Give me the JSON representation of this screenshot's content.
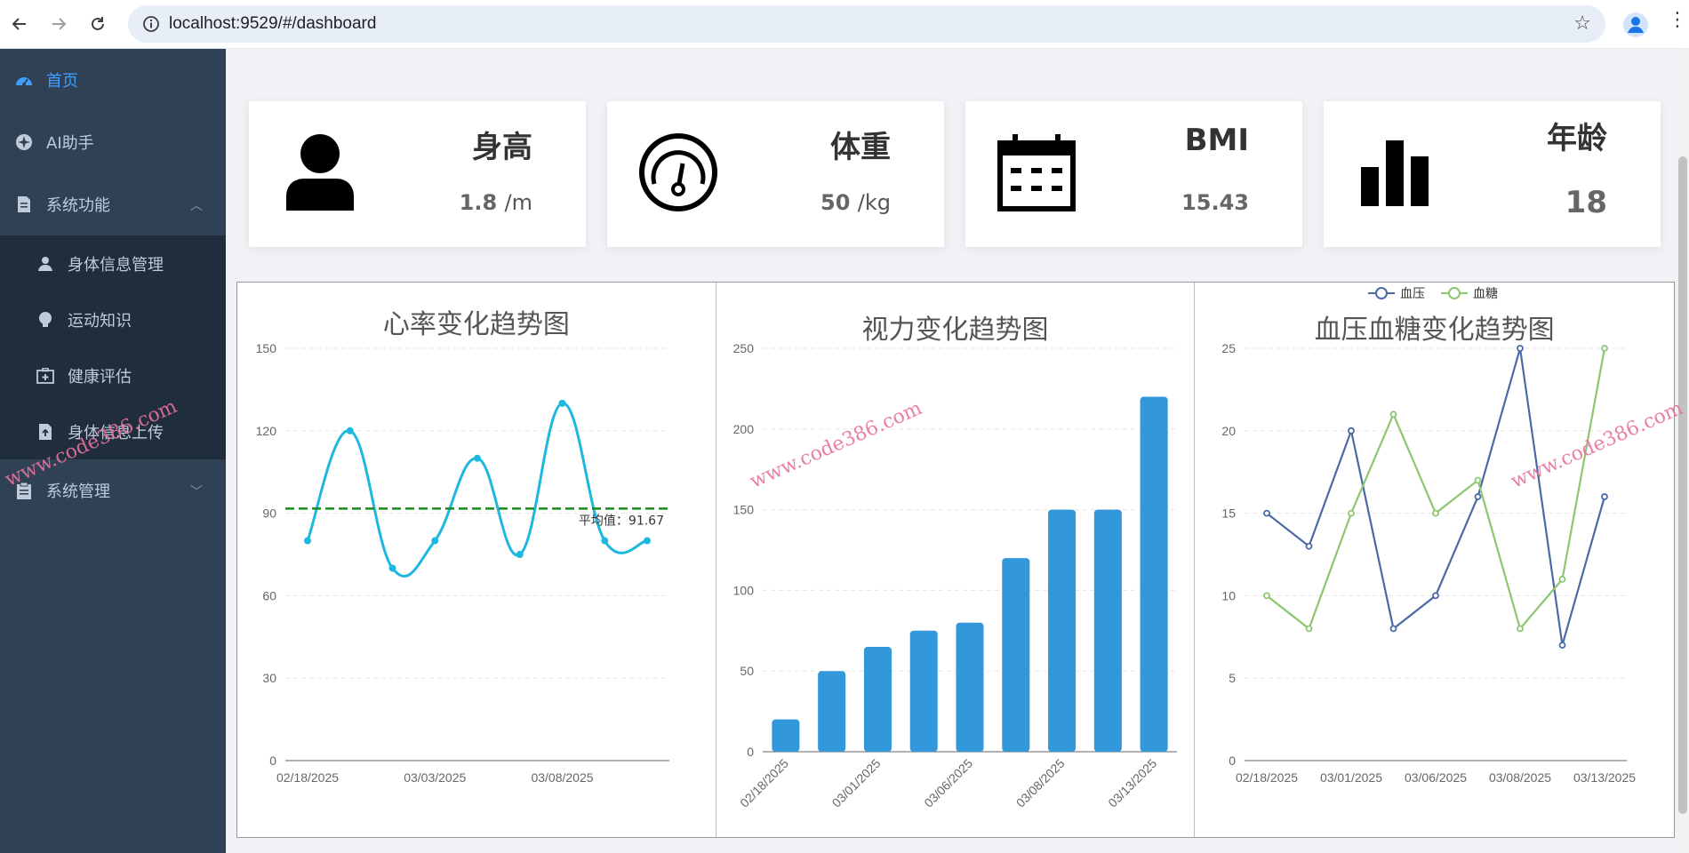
{
  "browser": {
    "url": "localhost:9529/#/dashboard",
    "back_icon": "arrow-left-icon",
    "forward_icon": "arrow-right-icon",
    "reload_icon": "reload-icon",
    "site_info_icon": "info-icon",
    "bookmark_icon": "star-icon",
    "profile_icon": "person-icon",
    "menu_icon": "kebab-icon"
  },
  "sidebar": {
    "items": [
      {
        "label": "首页",
        "icon": "dashboard-icon",
        "active": true
      },
      {
        "label": "AI助手",
        "icon": "compass-icon"
      },
      {
        "label": "系统功能",
        "icon": "document-icon",
        "expanded": true
      }
    ],
    "submenu": [
      {
        "label": "身体信息管理",
        "icon": "user-icon"
      },
      {
        "label": "运动知识",
        "icon": "bulb-icon"
      },
      {
        "label": "健康评估",
        "icon": "medical-box-icon"
      },
      {
        "label": "身体信息上传",
        "icon": "upload-doc-icon"
      }
    ],
    "bottom": {
      "label": "系统管理",
      "icon": "clipboard-icon"
    }
  },
  "cards": [
    {
      "title": "身高",
      "value": "1.8",
      "unit": "/m",
      "icon": "person-icon"
    },
    {
      "title": "体重",
      "value": "50",
      "unit": "/kg",
      "icon": "gauge-icon"
    },
    {
      "title": "BMI",
      "value": "15.43",
      "unit": "",
      "icon": "calendar-icon"
    },
    {
      "title": "年龄",
      "value": "18",
      "unit": "",
      "icon": "bar-chart-icon"
    }
  ],
  "watermark": "www.code386.com",
  "chart_data": [
    {
      "type": "line",
      "title": "心率变化趋势图",
      "x": [
        "02/18/2025",
        "",
        "",
        "03/03/2025",
        "",
        "",
        "03/08/2025",
        "",
        "",
        ""
      ],
      "x_tick_labels": [
        "02/18/2025",
        "03/03/2025",
        "03/08/2025"
      ],
      "series": [
        {
          "values": [
            80,
            120,
            70,
            80,
            110,
            75,
            130,
            80,
            80
          ],
          "color": "#1db8e0",
          "smooth": true
        }
      ],
      "mark_line": {
        "label": "平均值：91.67",
        "value": 91.67,
        "color": "#1a8a1a"
      },
      "ylim": [
        0,
        150
      ],
      "yticks": [
        0,
        30,
        60,
        90,
        120,
        150
      ],
      "grid": true
    },
    {
      "type": "bar",
      "title": "视力变化趋势图",
      "categories": [
        "02/18/2025",
        "",
        "03/01/2025",
        "",
        "03/06/2025",
        "",
        "03/08/2025",
        "",
        "03/13/2025"
      ],
      "x_tick_labels": [
        "02/18/2025",
        "03/01/2025",
        "03/06/2025",
        "03/08/2025",
        "03/13/2025"
      ],
      "values": [
        20,
        50,
        65,
        75,
        80,
        120,
        150,
        150,
        220
      ],
      "color": "#3398db",
      "ylim": [
        0,
        250
      ],
      "yticks": [
        0,
        50,
        100,
        150,
        200,
        250
      ],
      "grid": true
    },
    {
      "type": "line",
      "title": "血压血糖变化趋势图",
      "x_tick_labels": [
        "02/18/2025",
        "03/01/2025",
        "03/06/2025",
        "03/08/2025",
        "03/13/2025"
      ],
      "series": [
        {
          "name": "血压",
          "values": [
            15,
            13,
            20,
            8,
            10,
            16,
            25,
            7,
            16
          ],
          "color": "#4a6aa5"
        },
        {
          "name": "血糖",
          "values": [
            10,
            8,
            15,
            21,
            15,
            17,
            8,
            11,
            25
          ],
          "color": "#8cc76f"
        }
      ],
      "legend_position": "top-center",
      "ylim": [
        0,
        25
      ],
      "yticks": [
        0,
        5,
        10,
        15,
        20,
        25
      ],
      "grid": true
    }
  ]
}
